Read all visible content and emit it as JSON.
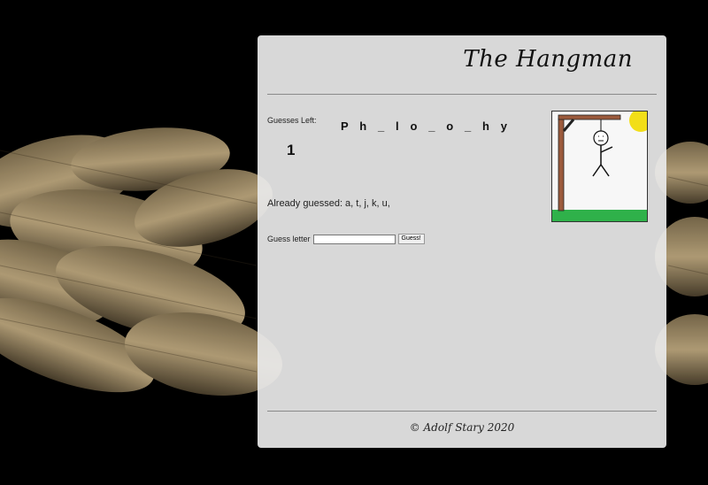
{
  "header": {
    "title": "The Hangman"
  },
  "game": {
    "guesses_left_label": "Guesses Left:",
    "guesses_left_value": "1",
    "word_display": "P h _ l o _ o _ h y",
    "already_guessed": "Already guessed: a, t, j, k, u,"
  },
  "form": {
    "label": "Guess letter",
    "input_value": "",
    "button_label": "Guess!"
  },
  "footer": {
    "text": "© Adolf Stary 2020"
  },
  "colors": {
    "sun": "#f2de18",
    "grass": "#2fb14a",
    "gallows": "#9b5a3c",
    "panel": "#e8e8e8"
  }
}
